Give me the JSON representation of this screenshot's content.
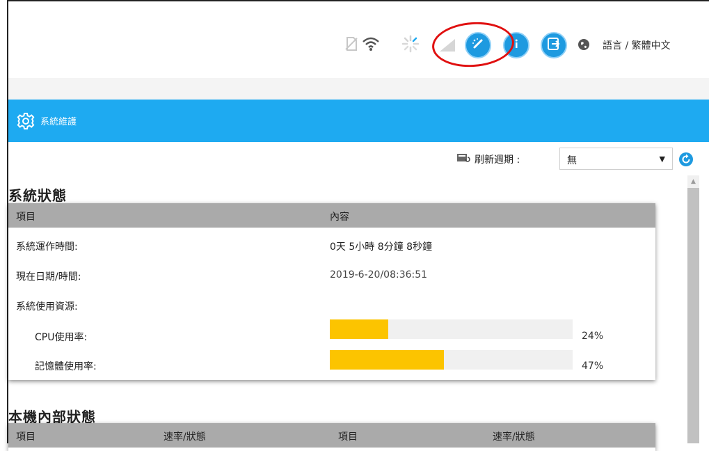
{
  "header": {
    "language_label": "語言 / 繁體中文",
    "icons": [
      "sim-icon",
      "wifi-icon",
      "loading-icon",
      "signal-icon",
      "wizard-icon",
      "info-icon",
      "logout-icon",
      "globe-icon"
    ]
  },
  "titlebar": {
    "title": "系統維護"
  },
  "refresh": {
    "label": "刷新週期 :",
    "selected": "無"
  },
  "system_status": {
    "title": "系統狀態",
    "columns": [
      "項目",
      "內容"
    ],
    "rows": [
      {
        "label": "系統運作時間:",
        "value": "0天 5小時 8分鐘 8秒鐘"
      },
      {
        "label": "現在日期/時間:",
        "value": "2019-6-20/08:36:51"
      },
      {
        "label": "系統使用資源:",
        "value": ""
      }
    ],
    "resources": [
      {
        "label": "CPU使用率:",
        "percent_text": "24%",
        "fraction": 0.24
      },
      {
        "label": "記憶體使用率:",
        "percent_text": "47%",
        "fraction": 0.47
      }
    ]
  },
  "internal_status": {
    "title": "本機內部狀態",
    "columns": [
      "項目",
      "速率/狀態",
      "項目",
      "速率/狀態"
    ]
  },
  "colors": {
    "accent": "#1eaaf1",
    "button": "#1e9ae0",
    "bar": "#fcc400",
    "highlight_ring": "#e01010"
  }
}
